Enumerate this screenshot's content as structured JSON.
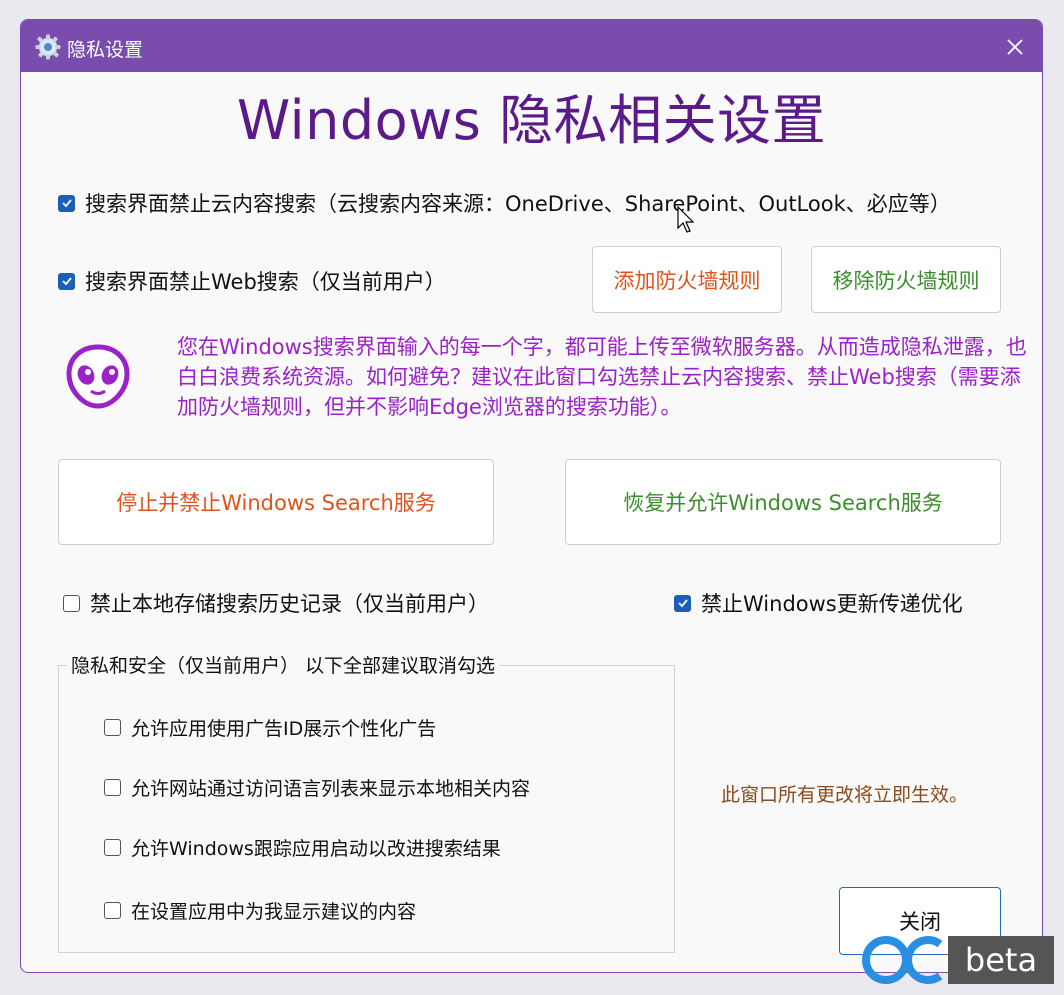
{
  "window": {
    "title": "隐私设置",
    "close_icon": "close-icon",
    "app_icon": "gear-icon"
  },
  "heading": "Windows 隐私相关设置",
  "options": {
    "cloud_search": {
      "label": "搜索界面禁止云内容搜索（云搜索内容来源：OneDrive、SharePoint、OutLook、必应等）",
      "checked": true
    },
    "web_search": {
      "label": "搜索界面禁止Web搜索（仅当前用户）",
      "checked": true
    },
    "local_history": {
      "label": "禁止本地存储搜索历史记录（仅当前用户）",
      "checked": false
    },
    "delivery_opt": {
      "label": "禁止Windows更新传递优化",
      "checked": true
    }
  },
  "buttons": {
    "add_firewall": "添加防火墙规则",
    "remove_firewall": "移除防火墙规则",
    "stop_search": "停止并禁止Windows Search服务",
    "restore_search": "恢复并允许Windows Search服务",
    "close": "关闭"
  },
  "info_text": "您在Windows搜索界面输入的每一个字，都可能上传至微软服务器。从而造成隐私泄露，也白白浪费系统资源。如何避免？建议在此窗口勾选禁止云内容搜索、禁止Web搜索（需要添加防火墙规则，但并不影响Edge浏览器的搜索功能）。",
  "privacy_group": {
    "title": "隐私和安全（仅当前用户） 以下全部建议取消勾选",
    "items": [
      {
        "label": "允许应用使用广告ID展示个性化广告",
        "checked": false
      },
      {
        "label": "允许网站通过访问语言列表来显示本地相关内容",
        "checked": false
      },
      {
        "label": "允许Windows跟踪应用启动以改进搜索结果",
        "checked": false
      },
      {
        "label": "在设置应用中为我显示建议的内容",
        "checked": false
      }
    ]
  },
  "notice": "此窗口所有更改将立即生效。",
  "watermark": {
    "text": "beta"
  },
  "colors": {
    "titlebar": "#7a4cad",
    "heading": "#5a1a8a",
    "info": "#9a22c8",
    "orange": "#e0531a",
    "green": "#3a8f2c",
    "checkbox": "#1b5fb8"
  }
}
